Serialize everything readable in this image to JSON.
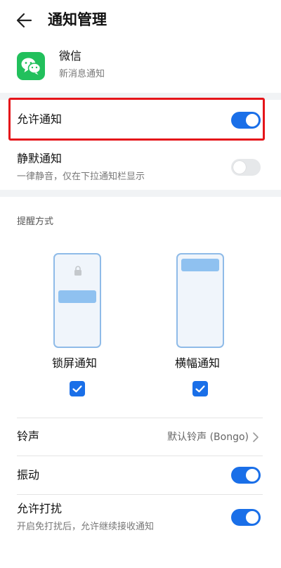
{
  "header": {
    "title": "通知管理",
    "back_icon": "arrow-left-icon"
  },
  "app": {
    "name": "微信",
    "subtitle": "新消息通知",
    "icon": "wechat-icon",
    "icon_color": "#22c05c"
  },
  "allow_notifications": {
    "label": "允许通知",
    "enabled": true
  },
  "silent_notifications": {
    "label": "静默通知",
    "description": "一律静音，仅在下拉通知栏显示",
    "enabled": false
  },
  "reminder": {
    "section_label": "提醒方式",
    "modes": [
      {
        "label": "锁屏通知",
        "checked": true
      },
      {
        "label": "横幅通知",
        "checked": true
      }
    ]
  },
  "ringtone": {
    "label": "铃声",
    "value": "默认铃声 (Bongo)"
  },
  "vibration": {
    "label": "振动",
    "enabled": true
  },
  "allow_disturb": {
    "label": "允许打扰",
    "description": "开启免打扰后，允许继续接收通知",
    "enabled": true
  },
  "colors": {
    "accent": "#1a6fe8",
    "highlight": "#e5151a",
    "section_bg": "#f1f3f5"
  }
}
